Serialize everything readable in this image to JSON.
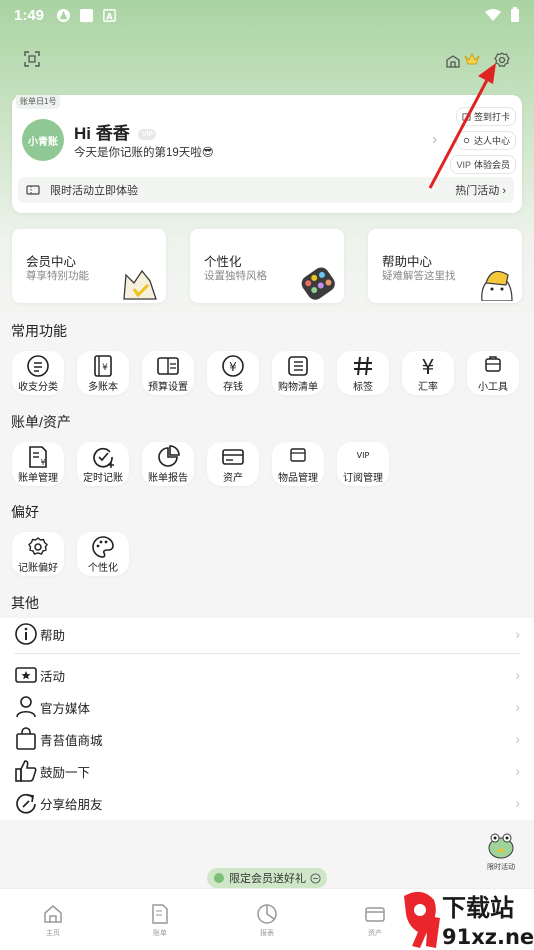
{
  "status_bar": {
    "time": "1:49"
  },
  "profile": {
    "day_tag": "账单日1号",
    "avatar_text": "小青账",
    "greeting": "Hi 香香",
    "vip_badge": "VIP",
    "days_text": "今天是你记账的第19天啦😎",
    "side_links": [
      "签到打卡",
      "达人中心",
      "体验会员"
    ],
    "side_link_vip_prefix": "VIP",
    "promo_left": "限时活动立即体验",
    "promo_right": "热门活动 ›"
  },
  "feature_cards": [
    {
      "title": "会员中心",
      "subtitle": "尊享特别功能"
    },
    {
      "title": "个性化",
      "subtitle": "设置独特风格"
    },
    {
      "title": "帮助中心",
      "subtitle": "疑难解答这里找"
    }
  ],
  "sections": {
    "common": {
      "title": "常用功能",
      "items": [
        "收支分类",
        "多账本",
        "预算设置",
        "存钱",
        "购物清单",
        "标签",
        "汇率",
        "小工具"
      ]
    },
    "bills": {
      "title": "账单/资产",
      "items": [
        "账单管理",
        "定时记账",
        "账单报告",
        "资产",
        "物品管理",
        "订阅管理"
      ]
    },
    "prefs": {
      "title": "偏好",
      "items": [
        "记账偏好",
        "个性化"
      ]
    },
    "other": {
      "title": "其他",
      "items": [
        "帮助",
        "活动",
        "官方媒体",
        "青苔值商城",
        "鼓励一下",
        "分享给朋友"
      ]
    }
  },
  "float_label": "限时活动",
  "promo_pill": "限定会员送好礼",
  "tabs": [
    "主页",
    "账单",
    "报表",
    "资产"
  ],
  "watermark": {
    "brand": "下载站",
    "url": "91xz.net"
  },
  "colors": {
    "accent_green": "#8fc894",
    "arrow_red": "#e02424"
  }
}
